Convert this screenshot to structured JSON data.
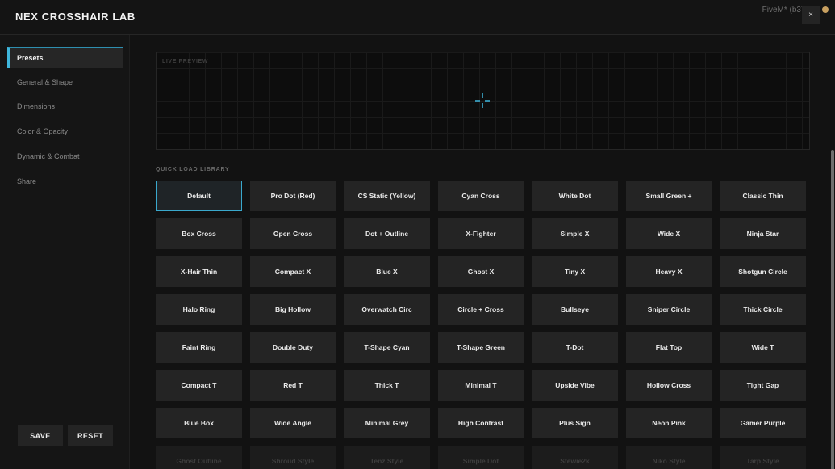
{
  "app": {
    "title": "NEX CROSSHAIR LAB",
    "host": "FiveM* (b3751)",
    "close_label": "×"
  },
  "sidebar": {
    "items": [
      {
        "label": "Presets",
        "active": true
      },
      {
        "label": "General & Shape",
        "active": false
      },
      {
        "label": "Dimensions",
        "active": false
      },
      {
        "label": "Color & Opacity",
        "active": false
      },
      {
        "label": "Dynamic & Combat",
        "active": false
      },
      {
        "label": "Share",
        "active": false
      }
    ],
    "save_label": "SAVE",
    "reset_label": "RESET"
  },
  "preview": {
    "label": "LIVE PREVIEW",
    "crosshair_color": "#3fb6dc"
  },
  "library": {
    "label": "QUICK LOAD LIBRARY",
    "active_index": 0,
    "presets": [
      "Default",
      "Pro Dot (Red)",
      "CS Static (Yellow)",
      "Cyan Cross",
      "White Dot",
      "Small Green +",
      "Classic Thin",
      "Box Cross",
      "Open Cross",
      "Dot + Outline",
      "X-Fighter",
      "Simple X",
      "Wide X",
      "Ninja Star",
      "X-Hair Thin",
      "Compact X",
      "Blue X",
      "Ghost X",
      "Tiny X",
      "Heavy X",
      "Shotgun Circle",
      "Halo Ring",
      "Big Hollow",
      "Overwatch Circ",
      "Circle + Cross",
      "Bullseye",
      "Sniper Circle",
      "Thick Circle",
      "Faint Ring",
      "Double Duty",
      "T-Shape Cyan",
      "T-Shape Green",
      "T-Dot",
      "Flat Top",
      "Wide T",
      "Compact T",
      "Red T",
      "Thick T",
      "Minimal T",
      "Upside Vibe",
      "Hollow Cross",
      "Tight Gap",
      "Blue Box",
      "Wide Angle",
      "Minimal Grey",
      "High Contrast",
      "Plus Sign",
      "Neon Pink",
      "Gamer Purple",
      "Ghost Outline",
      "Shroud Style",
      "Tenz Style",
      "Simple Dot",
      "Stewie2k",
      "Niko Style",
      "Tarp Style"
    ]
  },
  "colors": {
    "accent": "#3fb6dc",
    "background": "#121212",
    "button": "#242424"
  }
}
